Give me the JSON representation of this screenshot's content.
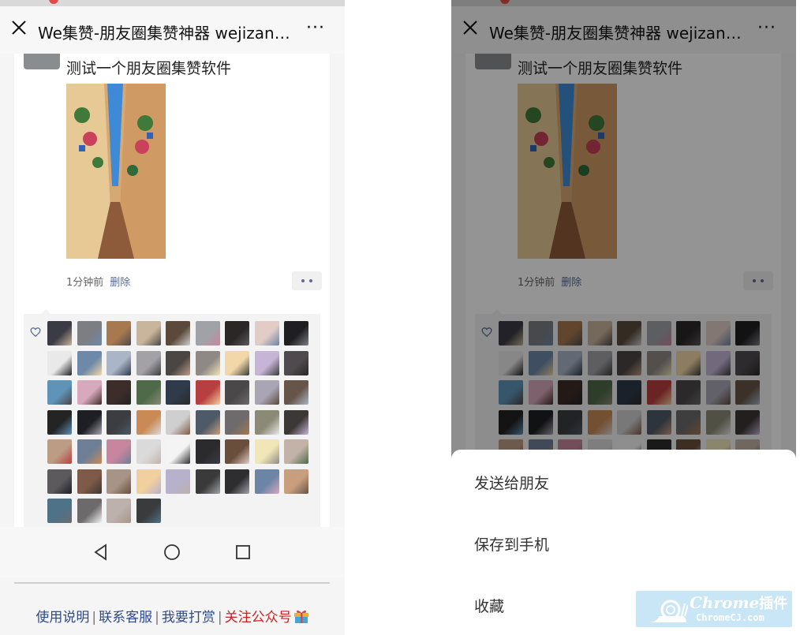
{
  "browser": {
    "title": "We集赞-朋友圈集赞神器 wejizan....",
    "more_label": "···"
  },
  "post": {
    "text": "测试一个朋友圈集赞软件",
    "time": "1分钟前",
    "delete_label": "删除"
  },
  "likes": {
    "avatar_count": 58,
    "palette": [
      "#3b3b45",
      "#7d7e84",
      "#a8794f",
      "#c9b59c",
      "#5b4a3c",
      "#9fa3a8",
      "#2a2726",
      "#e2cdc6",
      "#1f1f22",
      "#e9e9e9",
      "#6d88a8",
      "#aab6c8",
      "#a3a1a6",
      "#4a4644",
      "#8f8986",
      "#f2d8a8",
      "#c7b5d8",
      "#4f4a4e",
      "#5f93b8",
      "#d8a9bd",
      "#3d2d2a",
      "#4e6a48",
      "#2f3a4a",
      "#b83f3f",
      "#4a4848",
      "#a9a5b4",
      "#665548",
      "#242424",
      "#1d1f24",
      "#3b3d40",
      "#c98a56",
      "#cfcfcf",
      "#4e5a68",
      "#6d6b6c",
      "#8b8a76",
      "#3c3836",
      "#bd9c86",
      "#6f7f96",
      "#c8859e",
      "#dadada",
      "#f4f4f4",
      "#2b2b2e",
      "#6a4e3c",
      "#f0e6b8",
      "#c2b2a8",
      "#5c5a5d",
      "#7f5a48",
      "#a79486",
      "#f2cf9e",
      "#b7b1cc",
      "#3a3a3a",
      "#2e2e31",
      "#6c84a6",
      "#c99e7d",
      "#4e7288",
      "#6d6a6c",
      "#bcb1ad",
      "#3a3b3d"
    ]
  },
  "footer": {
    "instructions": "使用说明",
    "support": "联系客服",
    "tip": "我要打赏",
    "follow": "关注公众号",
    "separator": "|"
  },
  "sheet": {
    "send": "发送给朋友",
    "save": "保存到手机",
    "favorite": "收藏"
  },
  "watermark": {
    "brand": "Chrome",
    "brand_cn": "插件",
    "site": "ChromeCJ.com"
  },
  "colors": {
    "link_blue": "#586b94",
    "footer_blue": "#2c4a8c",
    "footer_red": "#cc2020",
    "overlay": "rgba(0,0,0,0.42)"
  },
  "icons": [
    "close-icon",
    "more-icon",
    "heart-icon",
    "back-nav-icon",
    "home-nav-icon",
    "recents-nav-icon",
    "gift-icon",
    "snail-icon"
  ]
}
